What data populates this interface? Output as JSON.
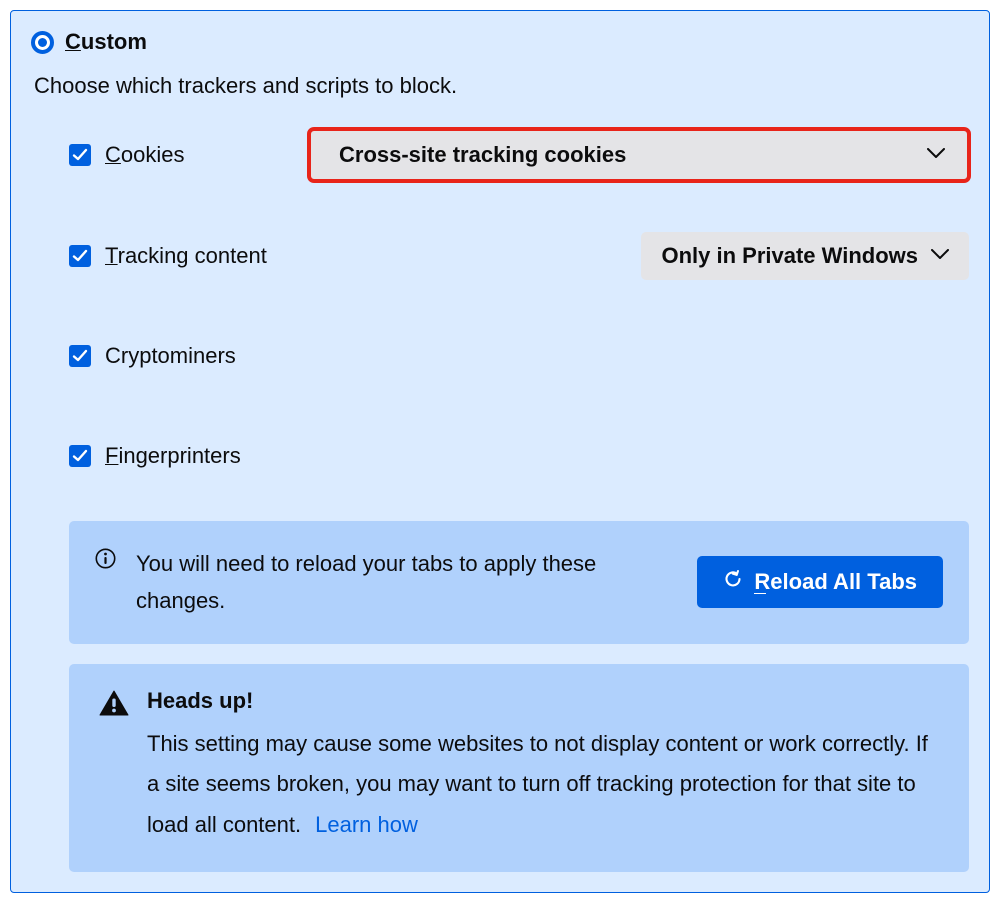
{
  "header": {
    "title": "Custom",
    "selected": true
  },
  "description": "Choose which trackers and scripts to block.",
  "options": {
    "cookies": {
      "label": "Cookies",
      "checked": true,
      "dropdown": "Cross-site tracking cookies",
      "highlighted": true
    },
    "tracking_content": {
      "label": "Tracking content",
      "checked": true,
      "dropdown": "Only in Private Windows"
    },
    "cryptominers": {
      "label": "Cryptominers",
      "checked": true
    },
    "fingerprinters": {
      "label": "Fingerprinters",
      "checked": true
    }
  },
  "reload_notice": {
    "text": "You will need to reload your tabs to apply these changes.",
    "button": "Reload All Tabs"
  },
  "warning": {
    "title": "Heads up!",
    "text": "This setting may cause some websites to not display content or work correctly. If a site seems broken, you may want to turn off tracking protection for that site to load all content.",
    "link": "Learn how"
  },
  "colors": {
    "accent": "#0060df",
    "panel_bg": "#dbebff",
    "notice_bg": "#b0d1fc",
    "highlight": "#e8241a"
  }
}
